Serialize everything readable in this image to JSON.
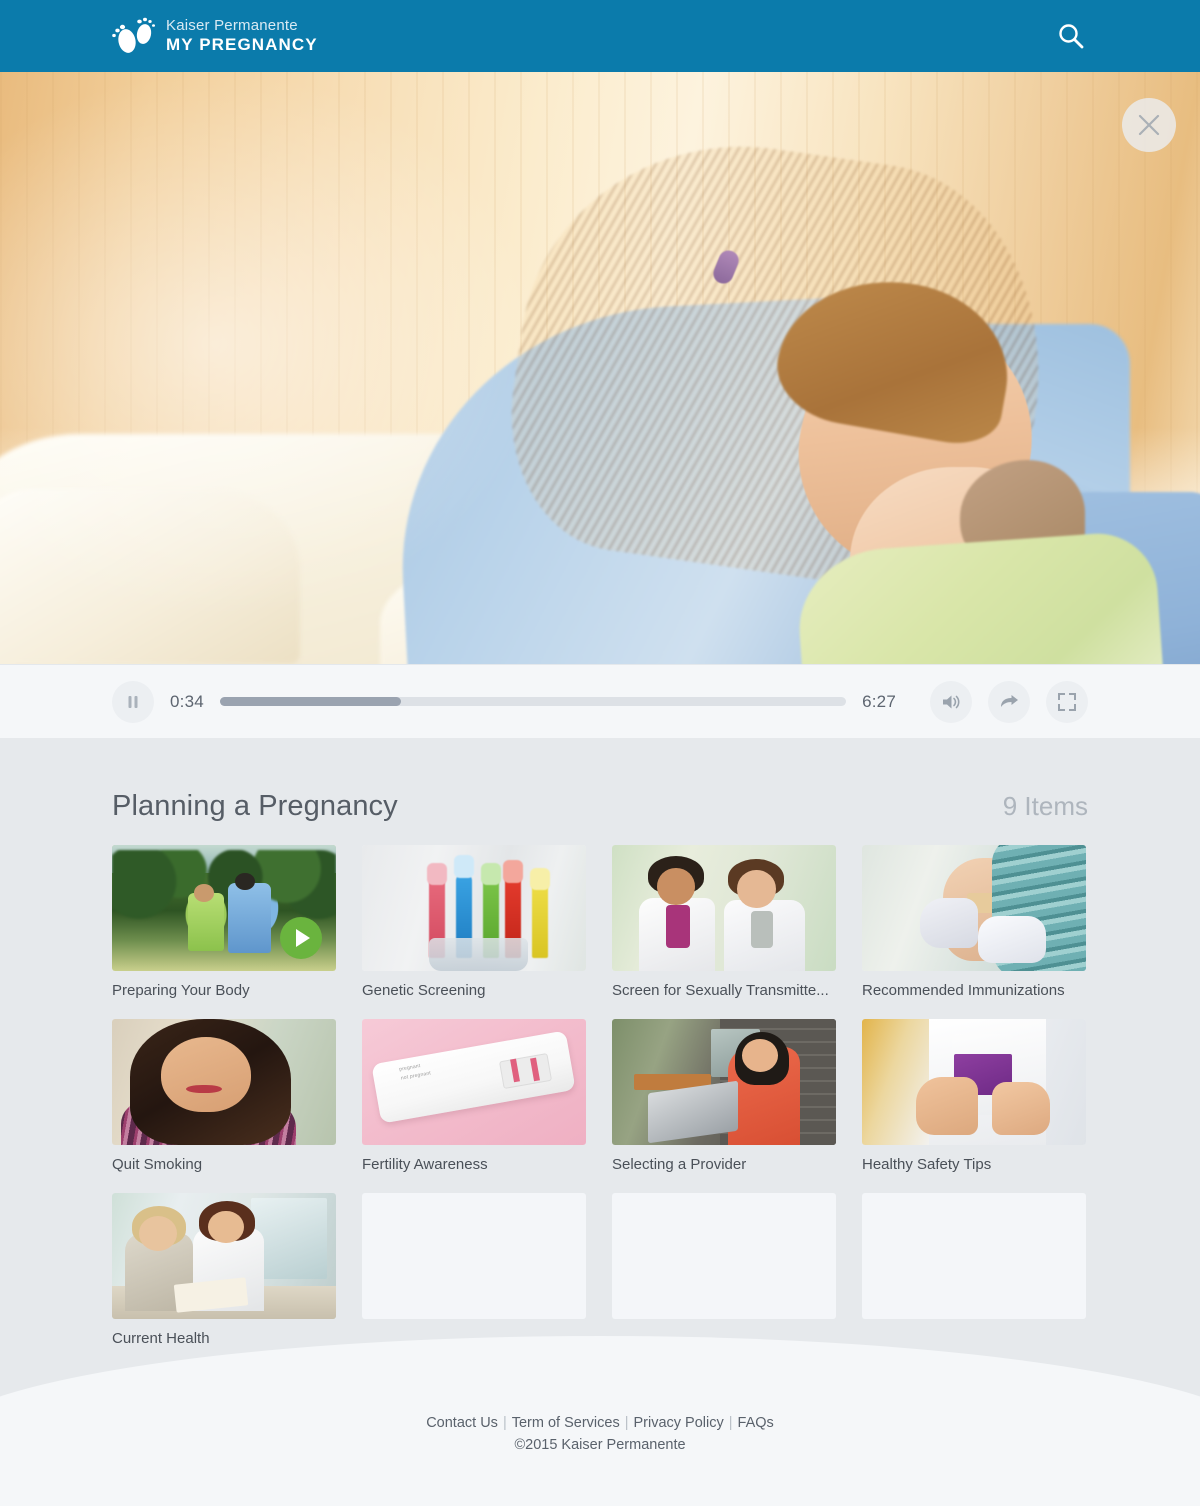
{
  "theme": {
    "header_blue": "#0b7bab",
    "content_bg": "#e6e9ec",
    "footer_bg": "#f5f7f9",
    "play_green": "#6ab43e",
    "progress_fill": "#9aa3b0",
    "progress_track": "#dde1e6"
  },
  "header": {
    "brand_top": "Kaiser Permanente",
    "brand_bottom": "MY PREGNANCY",
    "logo_icon": "footprints-icon",
    "search_icon": "search-icon"
  },
  "video": {
    "close_icon": "close-icon",
    "controls": {
      "play_pause_icon": "pause-icon",
      "current_time": "0:34",
      "total_time": "6:27",
      "progress_percent": 29,
      "volume_icon": "volume-icon",
      "share_icon": "share-icon",
      "fullscreen_icon": "fullscreen-icon"
    }
  },
  "section": {
    "title": "Planning a Pregnancy",
    "count_label": "9 Items",
    "items": [
      {
        "label": "Preparing Your Body",
        "art": "t-walk",
        "has_play": true
      },
      {
        "label": "Genetic Screening",
        "art": "t-brush",
        "has_play": false
      },
      {
        "label": "Screen for Sexually Transmitte...",
        "art": "t-docs",
        "has_play": false
      },
      {
        "label": "Recommended Immunizations",
        "art": "t-shot",
        "has_play": false
      },
      {
        "label": "Quit Smoking",
        "art": "t-smile",
        "has_play": false
      },
      {
        "label": "Fertility Awareness",
        "art": "t-test",
        "has_play": false
      },
      {
        "label": "Selecting a Provider",
        "art": "t-laptop",
        "has_play": false
      },
      {
        "label": "Healthy Safety Tips",
        "art": "t-pill",
        "has_play": false
      },
      {
        "label": "Current Health",
        "art": "t-consult",
        "has_play": false
      }
    ],
    "empty_placeholders": 3,
    "pregnancy_test_text_line1": "pregnant",
    "pregnancy_test_text_line2": "not pregnant"
  },
  "footer": {
    "links": [
      "Contact Us",
      "Term of Services",
      "Privacy Policy",
      "FAQs"
    ],
    "separator": "|",
    "copyright": "©2015 Kaiser Permanente"
  }
}
